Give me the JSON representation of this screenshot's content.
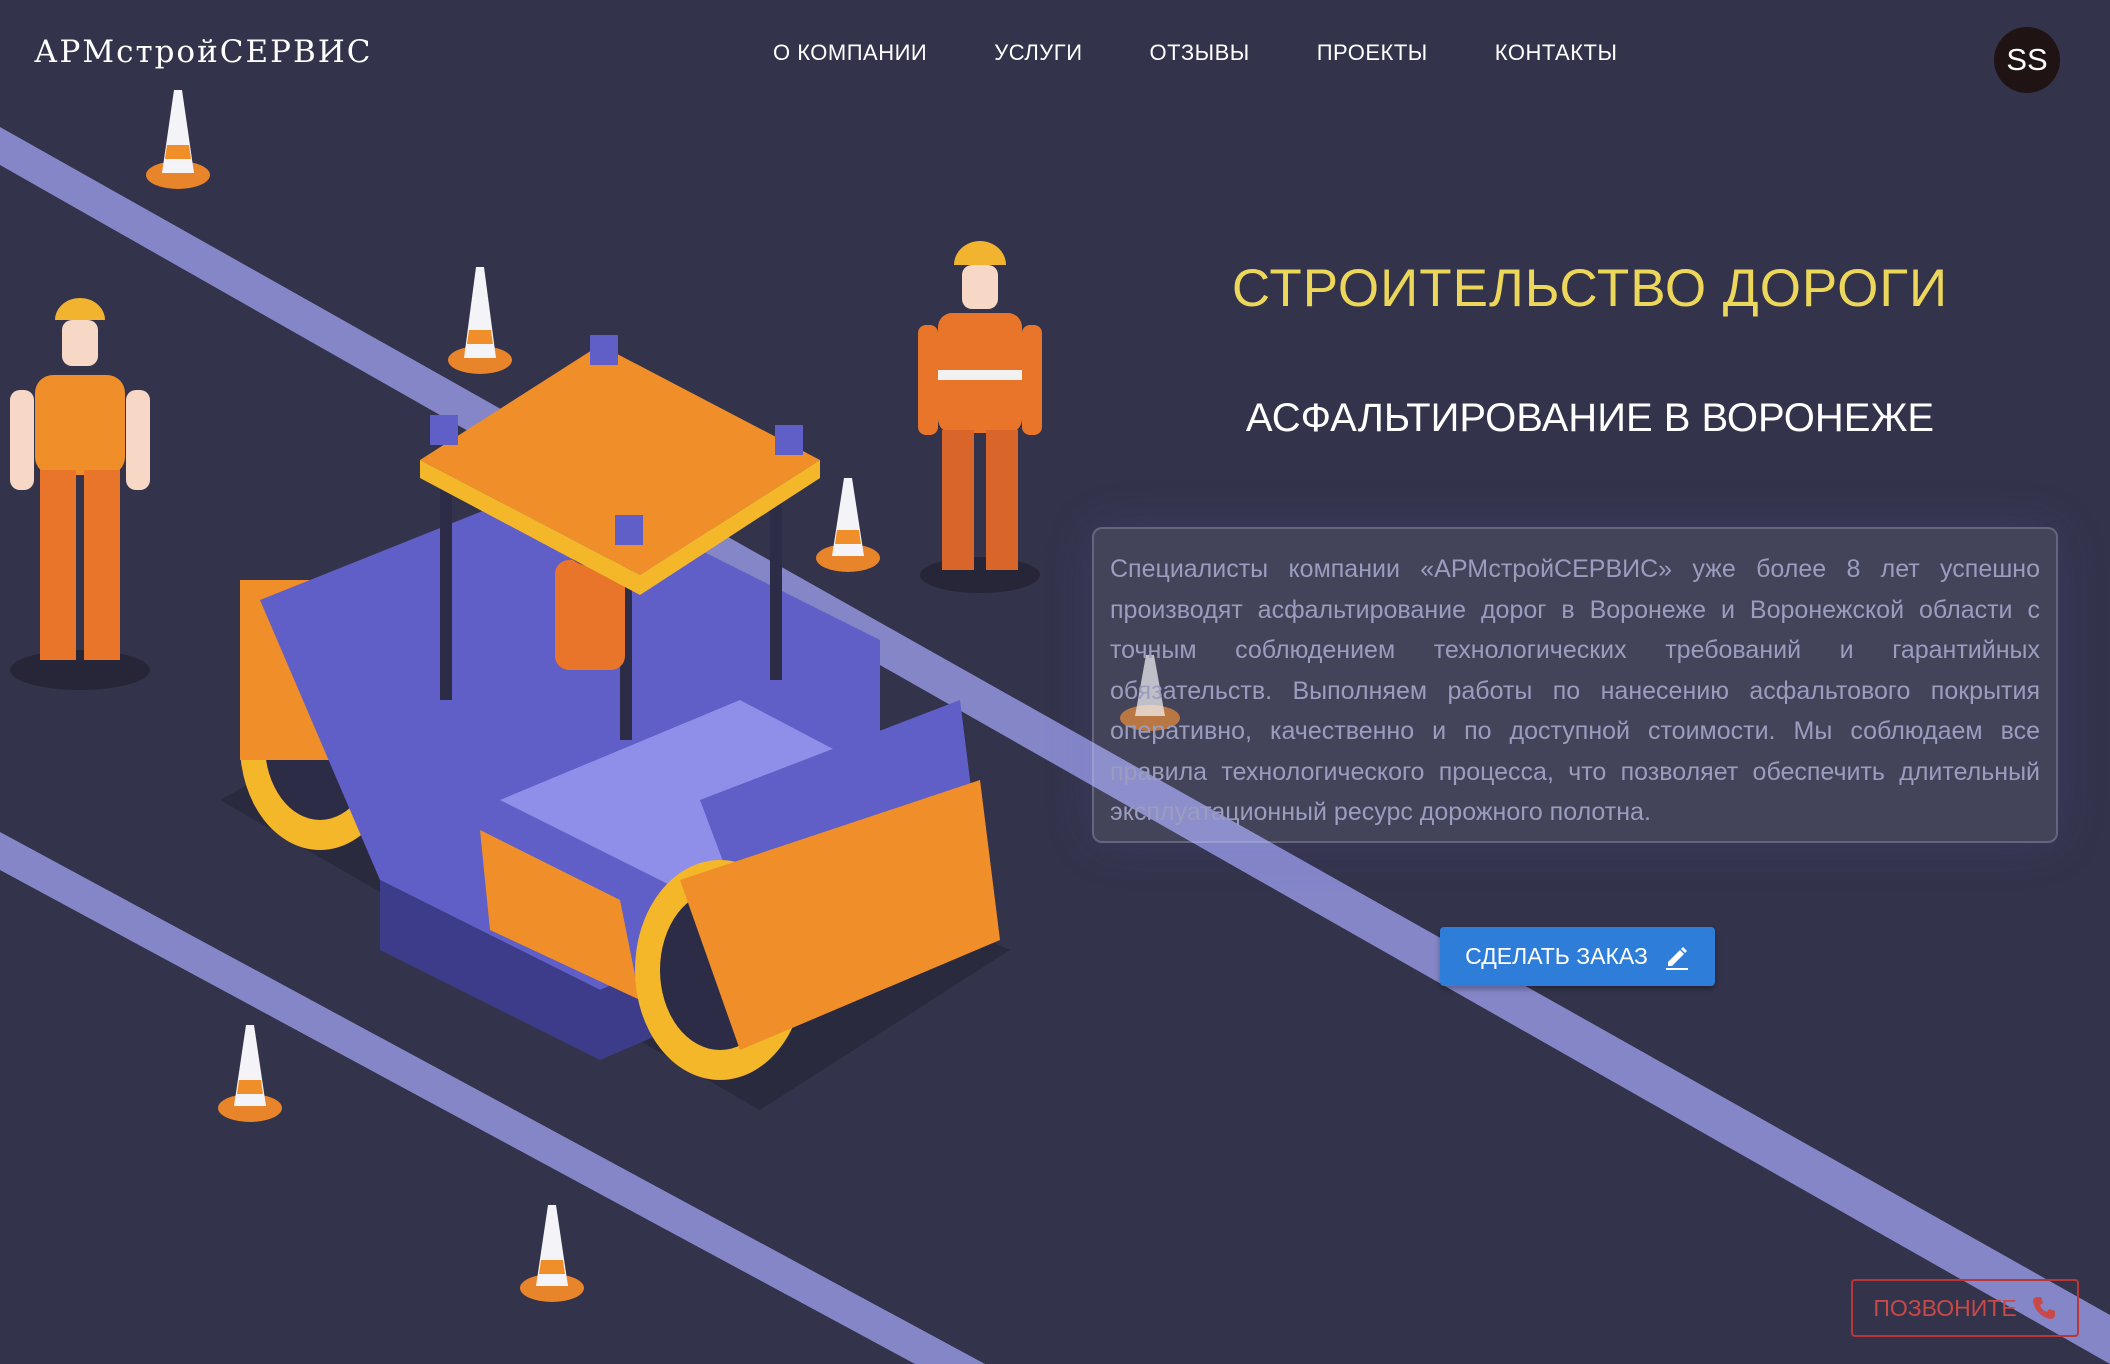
{
  "brand": {
    "logo": "АРМстройСЕРВИС"
  },
  "nav": {
    "items": [
      {
        "label": "О КОМПАНИИ"
      },
      {
        "label": "УСЛУГИ"
      },
      {
        "label": "ОТЗЫВЫ"
      },
      {
        "label": "ПРОЕКТЫ"
      },
      {
        "label": "КОНТАКТЫ"
      }
    ]
  },
  "user": {
    "avatar_initials": "SS"
  },
  "hero": {
    "title": "СТРОИТЕЛЬСТВО ДОРОГИ",
    "subtitle": "АСФАЛЬТИРОВАНИЕ В ВОРОНЕЖЕ",
    "description": "Специалисты компании «АРМстройСЕРВИС» уже более 8 лет успешно производят асфальтирование дорог в Воронеже и Воронежской области с точным соблюдением технологических требований и гарантийных обязательств. Выполняем работы по нанесению асфальтового покрытия оперативно, качественно и по доступной стоимости. Мы соблюдаем все правила технологического процесса, что позволяет обеспечить длительный эксплуатационный ресурс дорожного полотна."
  },
  "actions": {
    "order_label": "СДЕЛАТЬ ЗАКАЗ",
    "order_icon": "pencil-icon",
    "call_label": "ПОЗВОНИТЕ",
    "call_icon": "phone-icon"
  },
  "colors": {
    "background": "#33334b",
    "accent_yellow": "#ecd75a",
    "button_blue": "#2d7dd9",
    "call_red": "#c94848",
    "road_line": "#8486c8"
  }
}
